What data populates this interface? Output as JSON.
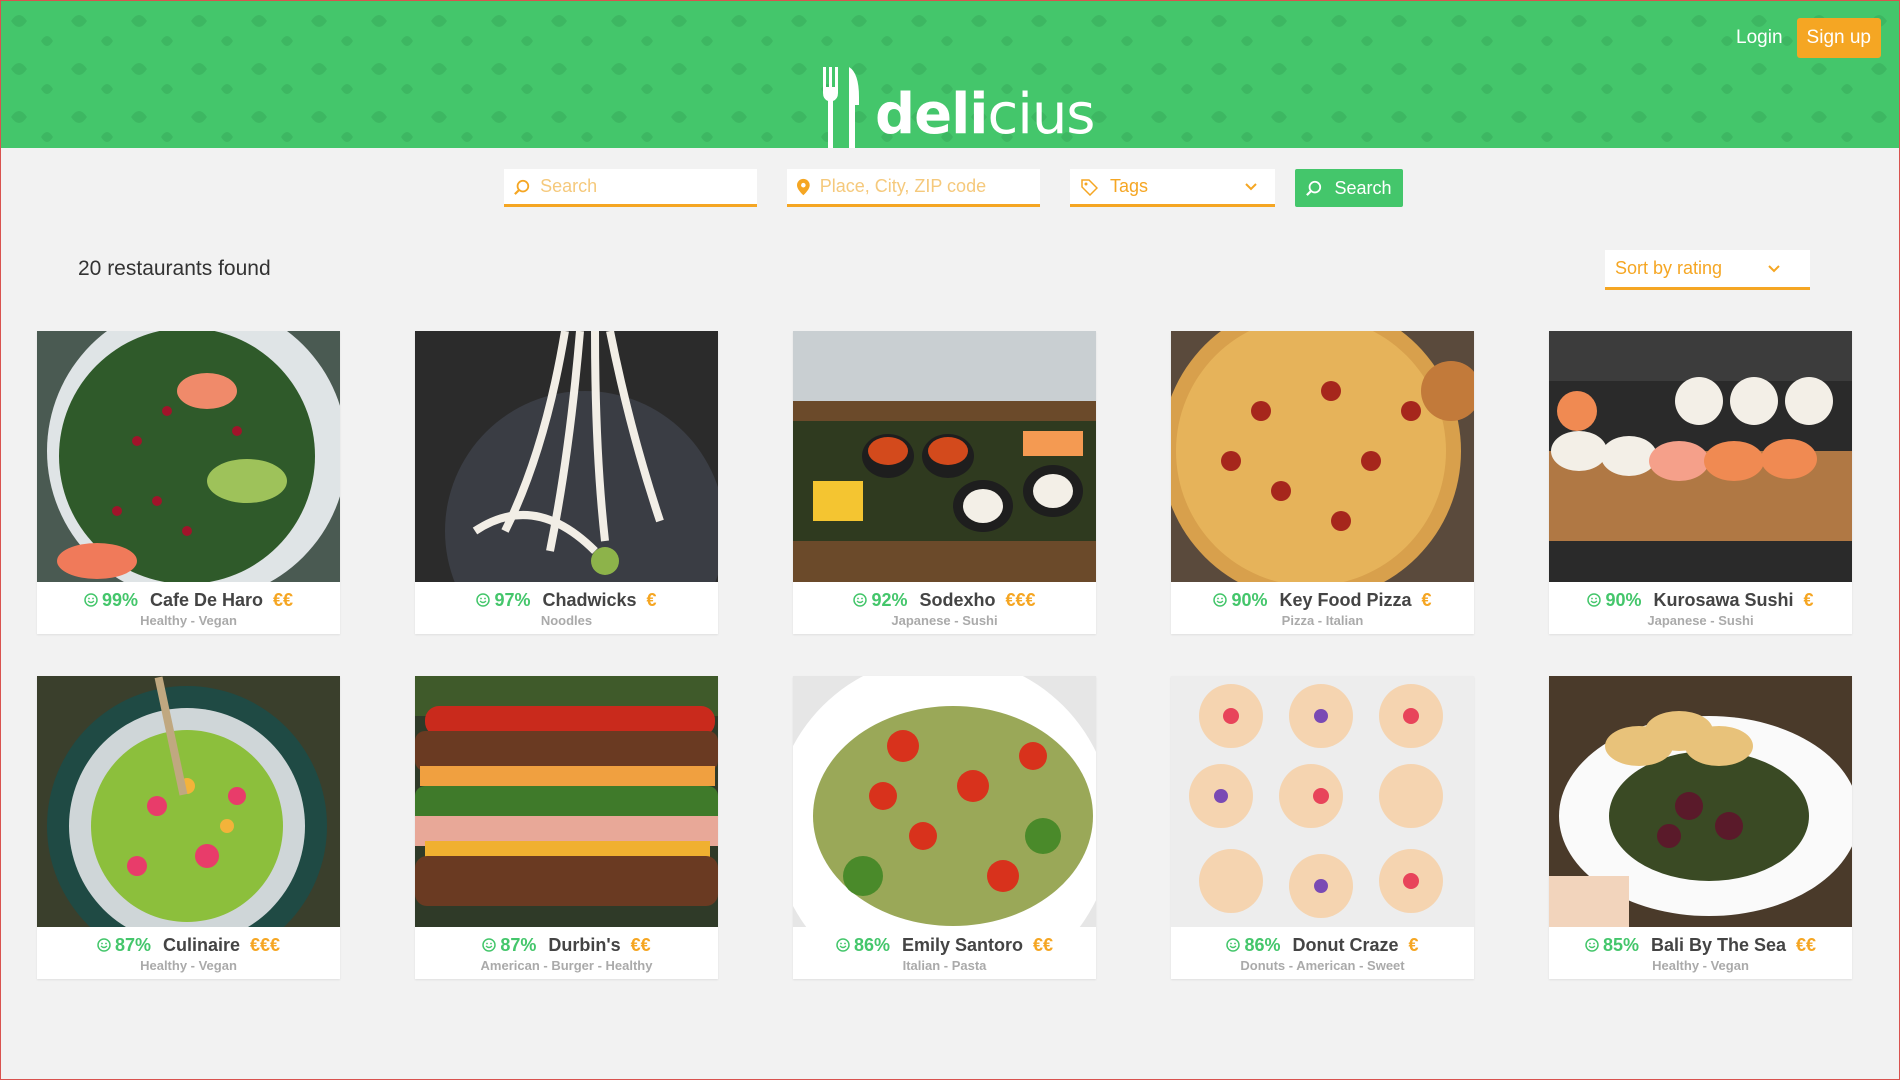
{
  "brand": {
    "name_bold": "deli",
    "name_light": "cius"
  },
  "auth": {
    "login": "Login",
    "signup": "Sign up"
  },
  "search": {
    "query_placeholder": "Search",
    "place_placeholder": "Place, City, ZIP code",
    "tags_label": "Tags",
    "button": "Search"
  },
  "results": {
    "count_text": "20 restaurants found",
    "sort_label": "Sort by rating"
  },
  "colors": {
    "brand_green": "#44c66b",
    "accent_orange": "#f5a623"
  },
  "restaurants": [
    {
      "rating": "99%",
      "name": "Cafe De Haro",
      "price": "€€",
      "tags": "Healthy - Vegan",
      "photo": "salad"
    },
    {
      "rating": "97%",
      "name": "Chadwicks",
      "price": "€",
      "tags": "Noodles",
      "photo": "noodles"
    },
    {
      "rating": "92%",
      "name": "Sodexho",
      "price": "€€€",
      "tags": "Japanese - Sushi",
      "photo": "sushi-board"
    },
    {
      "rating": "90%",
      "name": "Key Food Pizza",
      "price": "€",
      "tags": "Pizza - Italian",
      "photo": "pizza"
    },
    {
      "rating": "90%",
      "name": "Kurosawa Sushi",
      "price": "€",
      "tags": "Japanese - Sushi",
      "photo": "nigiri"
    },
    {
      "rating": "87%",
      "name": "Culinaire",
      "price": "€€€",
      "tags": "Healthy - Vegan",
      "photo": "bowl"
    },
    {
      "rating": "87%",
      "name": "Durbin's",
      "price": "€€",
      "tags": "American - Burger - Healthy",
      "photo": "burger"
    },
    {
      "rating": "86%",
      "name": "Emily Santoro",
      "price": "€€",
      "tags": "Italian - Pasta",
      "photo": "pasta"
    },
    {
      "rating": "86%",
      "name": "Donut Craze",
      "price": "€",
      "tags": "Donuts - American - Sweet",
      "photo": "donuts"
    },
    {
      "rating": "85%",
      "name": "Bali By The Sea",
      "price": "€€",
      "tags": "Healthy - Vegan",
      "photo": "plate"
    }
  ]
}
